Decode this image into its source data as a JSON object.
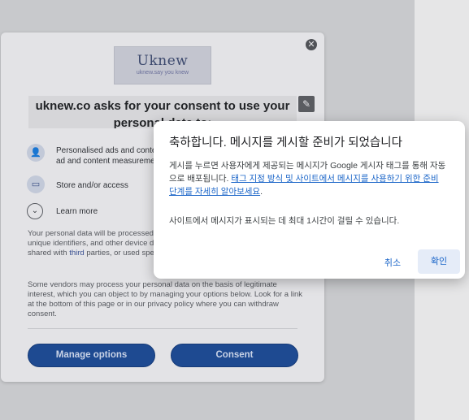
{
  "consent": {
    "logo_name": "Uknew",
    "logo_tagline": "uknew.say you knew",
    "title": "uknew.co asks for your consent to use your personal data to:",
    "purposes": [
      {
        "icon": "person-icon",
        "label": "Personalised ads and content, ad and content measurement, audience insights and product development"
      },
      {
        "icon": "device-icon",
        "label": "Store and/or access information on a device"
      }
    ],
    "learn_more": "Learn more",
    "paragraph1_start": "Your personal data will be processed and information from your device (cookies, unique identifiers, and other device data) may be stored by, accessed by and shared with ",
    "paragraph1_link": "third",
    "paragraph1_end": " parties, or used specifically by this site or app.",
    "paragraph2": "Some vendors may process your personal data on the basis of legitimate interest, which you can object to by managing your options below. Look for a link at the bottom of this page or in our privacy policy where you can withdraw consent.",
    "manage_label": "Manage options",
    "consent_label": "Consent"
  },
  "dialog": {
    "title": "축하합니다. 메시지를 게시할 준비가 되었습니다",
    "body_prefix": "게시를 누르면 사용자에게 제공되는 메시지가 Google 게시자 태그를 통해 자동으로 배포됩니다. ",
    "body_link": "태그 지정 방식 및 사이트에서 메시지를 사용하기 위한 준비 단계를 자세히 알아보세요",
    "body_suffix": ".",
    "note": "사이트에서 메시지가 표시되는 데 최대 1시간이 걸릴 수 있습니다.",
    "cancel_label": "취소",
    "ok_label": "확인"
  }
}
